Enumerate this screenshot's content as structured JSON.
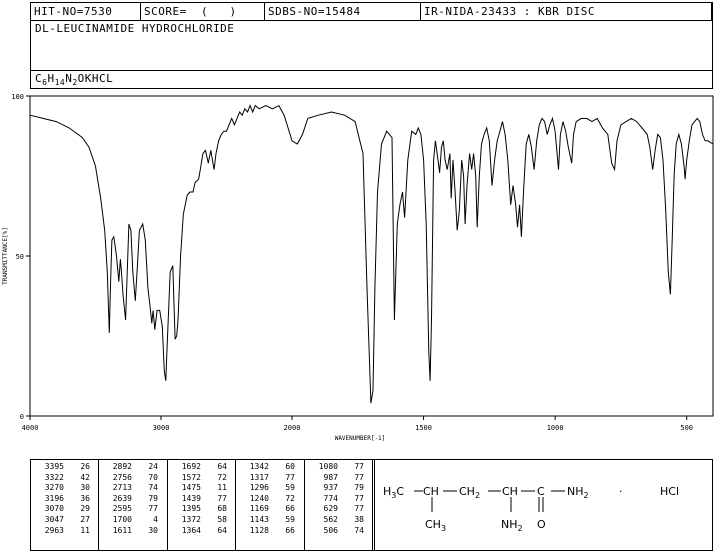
{
  "header": {
    "hit_no": "HIT-NO=7530",
    "score": "SCORE=  (   )",
    "sdbs_no": "SDBS-NO=15484",
    "ir_info": "IR-NIDA-23433 : KBR DISC"
  },
  "compound_name": "DL-LEUCINAMIDE HYDROCHLORIDE",
  "formula": {
    "parts": [
      "C",
      "6",
      "H",
      "14",
      "N",
      "2",
      "OKHCL"
    ]
  },
  "chart_data": {
    "type": "line",
    "xlabel": "WAVENUMBER[-1]",
    "ylabel": "TRANSMITTANCE[%]",
    "xlim": [
      4000,
      400
    ],
    "ylim": [
      0,
      100
    ],
    "x_ticks": [
      4000,
      3000,
      2000,
      1500,
      1000,
      500
    ],
    "y_ticks": [
      0,
      50,
      100
    ],
    "points": [
      [
        4000,
        94
      ],
      [
        3900,
        93
      ],
      [
        3800,
        92
      ],
      [
        3700,
        90
      ],
      [
        3600,
        87
      ],
      [
        3550,
        84
      ],
      [
        3500,
        78
      ],
      [
        3460,
        68
      ],
      [
        3430,
        58
      ],
      [
        3410,
        45
      ],
      [
        3395,
        26
      ],
      [
        3385,
        42
      ],
      [
        3375,
        55
      ],
      [
        3360,
        56
      ],
      [
        3340,
        50
      ],
      [
        3322,
        42
      ],
      [
        3310,
        49
      ],
      [
        3300,
        44
      ],
      [
        3290,
        38
      ],
      [
        3270,
        30
      ],
      [
        3260,
        42
      ],
      [
        3245,
        60
      ],
      [
        3230,
        58
      ],
      [
        3215,
        45
      ],
      [
        3196,
        36
      ],
      [
        3180,
        47
      ],
      [
        3165,
        58
      ],
      [
        3140,
        60
      ],
      [
        3120,
        55
      ],
      [
        3100,
        40
      ],
      [
        3080,
        33
      ],
      [
        3070,
        29
      ],
      [
        3060,
        33
      ],
      [
        3047,
        27
      ],
      [
        3030,
        33
      ],
      [
        3010,
        33
      ],
      [
        2990,
        28
      ],
      [
        2975,
        14
      ],
      [
        2963,
        11
      ],
      [
        2955,
        20
      ],
      [
        2945,
        30
      ],
      [
        2930,
        45
      ],
      [
        2910,
        47
      ],
      [
        2892,
        24
      ],
      [
        2880,
        25
      ],
      [
        2870,
        30
      ],
      [
        2850,
        50
      ],
      [
        2830,
        63
      ],
      [
        2800,
        69
      ],
      [
        2780,
        70
      ],
      [
        2756,
        70
      ],
      [
        2740,
        73
      ],
      [
        2713,
        74
      ],
      [
        2700,
        77
      ],
      [
        2680,
        82
      ],
      [
        2660,
        83
      ],
      [
        2639,
        79
      ],
      [
        2620,
        83
      ],
      [
        2595,
        77
      ],
      [
        2580,
        82
      ],
      [
        2560,
        86
      ],
      [
        2540,
        88
      ],
      [
        2520,
        89
      ],
      [
        2500,
        89
      ],
      [
        2480,
        91
      ],
      [
        2460,
        93
      ],
      [
        2440,
        91
      ],
      [
        2420,
        93
      ],
      [
        2400,
        95
      ],
      [
        2380,
        94
      ],
      [
        2360,
        96
      ],
      [
        2340,
        95
      ],
      [
        2320,
        97
      ],
      [
        2300,
        95
      ],
      [
        2280,
        97
      ],
      [
        2250,
        96
      ],
      [
        2200,
        97
      ],
      [
        2150,
        96
      ],
      [
        2100,
        97
      ],
      [
        2060,
        94
      ],
      [
        2030,
        90
      ],
      [
        2000,
        86
      ],
      [
        1980,
        85
      ],
      [
        1960,
        88
      ],
      [
        1940,
        93
      ],
      [
        1900,
        94
      ],
      [
        1850,
        95
      ],
      [
        1800,
        94
      ],
      [
        1760,
        92
      ],
      [
        1730,
        82
      ],
      [
        1715,
        40
      ],
      [
        1700,
        4
      ],
      [
        1692,
        8
      ],
      [
        1685,
        40
      ],
      [
        1675,
        70
      ],
      [
        1660,
        85
      ],
      [
        1640,
        89
      ],
      [
        1620,
        87
      ],
      [
        1611,
        30
      ],
      [
        1600,
        60
      ],
      [
        1590,
        66
      ],
      [
        1580,
        70
      ],
      [
        1572,
        62
      ],
      [
        1560,
        80
      ],
      [
        1545,
        89
      ],
      [
        1530,
        88
      ],
      [
        1520,
        90
      ],
      [
        1510,
        88
      ],
      [
        1500,
        80
      ],
      [
        1490,
        60
      ],
      [
        1480,
        20
      ],
      [
        1475,
        11
      ],
      [
        1470,
        30
      ],
      [
        1462,
        80
      ],
      [
        1455,
        86
      ],
      [
        1445,
        80
      ],
      [
        1439,
        76
      ],
      [
        1432,
        84
      ],
      [
        1425,
        86
      ],
      [
        1418,
        80
      ],
      [
        1410,
        77
      ],
      [
        1400,
        82
      ],
      [
        1395,
        68
      ],
      [
        1388,
        80
      ],
      [
        1380,
        70
      ],
      [
        1372,
        58
      ],
      [
        1364,
        64
      ],
      [
        1355,
        80
      ],
      [
        1348,
        75
      ],
      [
        1342,
        60
      ],
      [
        1335,
        72
      ],
      [
        1325,
        82
      ],
      [
        1317,
        77
      ],
      [
        1310,
        82
      ],
      [
        1302,
        75
      ],
      [
        1296,
        59
      ],
      [
        1288,
        75
      ],
      [
        1280,
        85
      ],
      [
        1270,
        88
      ],
      [
        1260,
        90
      ],
      [
        1250,
        86
      ],
      [
        1240,
        72
      ],
      [
        1230,
        80
      ],
      [
        1220,
        86
      ],
      [
        1210,
        89
      ],
      [
        1200,
        92
      ],
      [
        1190,
        88
      ],
      [
        1180,
        80
      ],
      [
        1169,
        66
      ],
      [
        1160,
        72
      ],
      [
        1150,
        66
      ],
      [
        1143,
        59
      ],
      [
        1135,
        66
      ],
      [
        1128,
        56
      ],
      [
        1120,
        70
      ],
      [
        1110,
        85
      ],
      [
        1100,
        88
      ],
      [
        1090,
        84
      ],
      [
        1080,
        77
      ],
      [
        1070,
        86
      ],
      [
        1060,
        91
      ],
      [
        1050,
        93
      ],
      [
        1040,
        92
      ],
      [
        1030,
        88
      ],
      [
        1020,
        91
      ],
      [
        1010,
        93
      ],
      [
        1000,
        89
      ],
      [
        987,
        77
      ],
      [
        980,
        88
      ],
      [
        970,
        92
      ],
      [
        960,
        89
      ],
      [
        950,
        84
      ],
      [
        937,
        79
      ],
      [
        930,
        88
      ],
      [
        920,
        92
      ],
      [
        900,
        93
      ],
      [
        880,
        93
      ],
      [
        860,
        92
      ],
      [
        840,
        93
      ],
      [
        820,
        90
      ],
      [
        800,
        88
      ],
      [
        785,
        79
      ],
      [
        774,
        77
      ],
      [
        765,
        86
      ],
      [
        750,
        91
      ],
      [
        730,
        92
      ],
      [
        710,
        93
      ],
      [
        690,
        92
      ],
      [
        670,
        90
      ],
      [
        650,
        88
      ],
      [
        640,
        84
      ],
      [
        629,
        77
      ],
      [
        620,
        83
      ],
      [
        610,
        88
      ],
      [
        600,
        87
      ],
      [
        590,
        80
      ],
      [
        580,
        65
      ],
      [
        570,
        45
      ],
      [
        562,
        38
      ],
      [
        555,
        55
      ],
      [
        548,
        75
      ],
      [
        540,
        85
      ],
      [
        530,
        88
      ],
      [
        520,
        85
      ],
      [
        510,
        78
      ],
      [
        506,
        74
      ],
      [
        500,
        80
      ],
      [
        490,
        86
      ],
      [
        480,
        91
      ],
      [
        470,
        92
      ],
      [
        460,
        93
      ],
      [
        450,
        92
      ],
      [
        440,
        88
      ],
      [
        430,
        86
      ],
      [
        420,
        86
      ],
      [
        400,
        85
      ]
    ]
  },
  "peak_table": {
    "columns": [
      [
        [
          "3395",
          "26"
        ],
        [
          "3322",
          "42"
        ],
        [
          "3270",
          "30"
        ],
        [
          "3196",
          "36"
        ],
        [
          "3070",
          "29"
        ],
        [
          "3047",
          "27"
        ],
        [
          "2963",
          "11"
        ]
      ],
      [
        [
          "2892",
          "24"
        ],
        [
          "2756",
          "70"
        ],
        [
          "2713",
          "74"
        ],
        [
          "2639",
          "79"
        ],
        [
          "2595",
          "77"
        ],
        [
          "1700",
          "4"
        ],
        [
          "1611",
          "30"
        ]
      ],
      [
        [
          "1692",
          "64"
        ],
        [
          "1572",
          "72"
        ],
        [
          "1475",
          "11"
        ],
        [
          "1439",
          "77"
        ],
        [
          "1395",
          "68"
        ],
        [
          "1372",
          "58"
        ],
        [
          "1364",
          "64"
        ]
      ],
      [
        [
          "1342",
          "60"
        ],
        [
          "1317",
          "77"
        ],
        [
          "1296",
          "59"
        ],
        [
          "1240",
          "72"
        ],
        [
          "1169",
          "66"
        ],
        [
          "1143",
          "59"
        ],
        [
          "1128",
          "66"
        ]
      ],
      [
        [
          "1080",
          "77"
        ],
        [
          "987",
          "77"
        ],
        [
          "937",
          "79"
        ],
        [
          "774",
          "77"
        ],
        [
          "629",
          "77"
        ],
        [
          "562",
          "38"
        ],
        [
          "506",
          "74"
        ]
      ]
    ]
  },
  "structure": {
    "h3c": "H",
    "h3c_sub": "3",
    "c1": "C",
    "ch": "CH",
    "ch2": "CH",
    "ch2_sub": "2",
    "ch_b": "CH",
    "c_amide": "C",
    "nh2": "NH",
    "nh2_sub": "2",
    "dot": "·",
    "hcl": "HCl",
    "ch3": "CH",
    "ch3_sub": "3",
    "nh2_b": "NH",
    "nh2_b_sub": "2",
    "o": "O"
  }
}
